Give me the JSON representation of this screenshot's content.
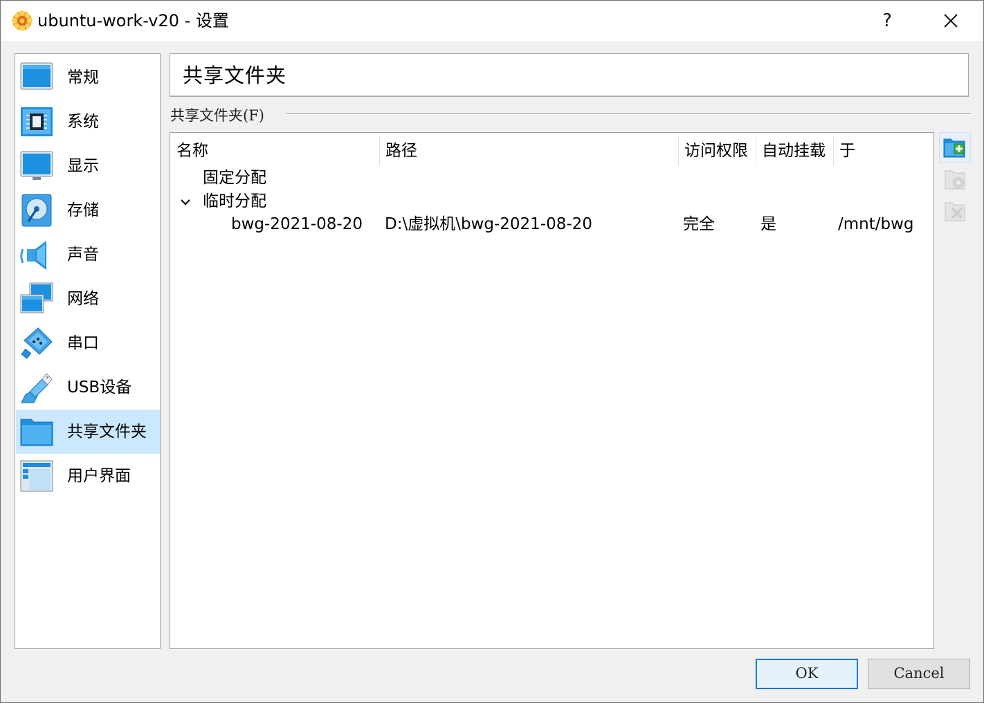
{
  "window": {
    "title": "ubuntu-work-v20 - 设置",
    "help_label": "?"
  },
  "sidebar": {
    "items": [
      {
        "label": "常规",
        "icon": "general-monitor-icon"
      },
      {
        "label": "系统",
        "icon": "chip-icon"
      },
      {
        "label": "显示",
        "icon": "display-monitor-icon"
      },
      {
        "label": "存储",
        "icon": "storage-disk-icon"
      },
      {
        "label": "声音",
        "icon": "speaker-icon"
      },
      {
        "label": "网络",
        "icon": "network-icon"
      },
      {
        "label": "串口",
        "icon": "serial-port-icon"
      },
      {
        "label": "USB设备",
        "icon": "usb-icon"
      },
      {
        "label": "共享文件夹",
        "icon": "shared-folder-icon",
        "selected": true
      },
      {
        "label": "用户界面",
        "icon": "user-interface-icon"
      }
    ]
  },
  "main": {
    "page_title": "共享文件夹",
    "group_label": "共享文件夹(F)",
    "table": {
      "columns": [
        "名称",
        "路径",
        "访问权限",
        "自动挂载",
        "于"
      ],
      "groups": [
        {
          "label": "固定分配",
          "expanded": false,
          "rows": []
        },
        {
          "label": "临时分配",
          "expanded": true,
          "rows": [
            {
              "name": "bwg-2021-08-20",
              "path": "D:\\虚拟机\\bwg-2021-08-20",
              "access": "完全",
              "auto_mount": "是",
              "at": "/mnt/bwg"
            }
          ]
        }
      ]
    },
    "tools": [
      "add-shared-folder-icon",
      "edit-shared-folder-icon",
      "remove-shared-folder-icon"
    ]
  },
  "buttons": {
    "ok": "OK",
    "cancel": "Cancel"
  },
  "colors": {
    "selection": "#cce8ff",
    "accent": "#0078d7",
    "icon_blue": "#1e90e0"
  }
}
